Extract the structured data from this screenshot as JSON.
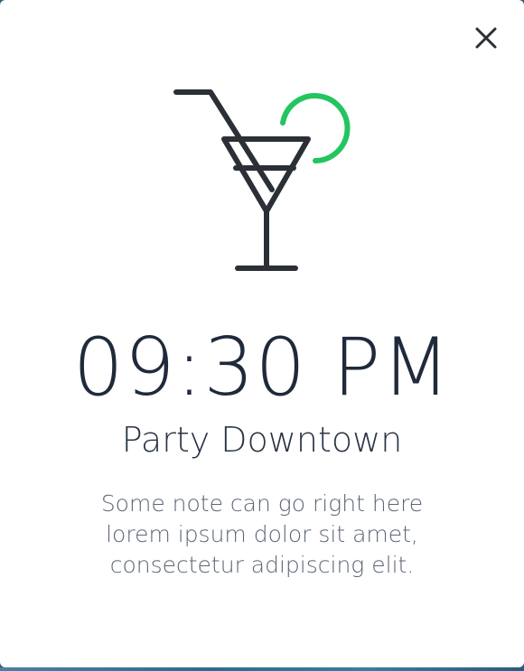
{
  "modal": {
    "close_icon": "close-icon",
    "illustration_icon": "cocktail-icon",
    "time": "09:30 PM",
    "title": "Party Downtown",
    "note": "Some note can go right here lorem ipsum dolor sit amet, consectetur adipiscing elit."
  },
  "colors": {
    "text_dark": "#1f2a3b",
    "text_muted": "#5c6677",
    "icon_stroke": "#2b2f36",
    "accent_green": "#22c55e",
    "background_white": "#ffffff"
  }
}
